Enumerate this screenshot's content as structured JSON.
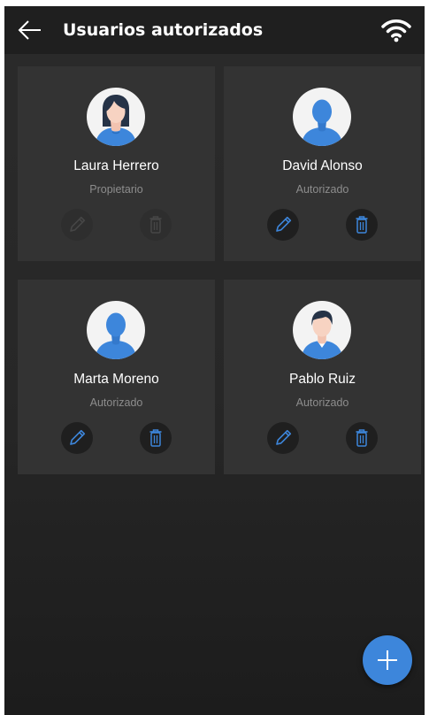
{
  "header": {
    "title": "Usuarios autorizados",
    "back_icon": "arrow-left-icon",
    "status_icon": "wifi-icon"
  },
  "users": [
    {
      "name": "Laura Herrero",
      "role": "Propietario",
      "avatar": "female-user-icon",
      "actions_enabled": false
    },
    {
      "name": "David Alonso",
      "role": "Autorizado",
      "avatar": "user-silhouette-icon",
      "actions_enabled": true
    },
    {
      "name": "Marta Moreno",
      "role": "Autorizado",
      "avatar": "user-silhouette-icon",
      "actions_enabled": true
    },
    {
      "name": "Pablo Ruiz",
      "role": "Autorizado",
      "avatar": "male-user-icon",
      "actions_enabled": true
    }
  ],
  "fab": {
    "icon": "plus-icon"
  },
  "colors": {
    "background": "#272727",
    "header": "#1f1f1f",
    "card": "#333333",
    "accent": "#3d86db",
    "role_text": "#8d8d8d"
  }
}
